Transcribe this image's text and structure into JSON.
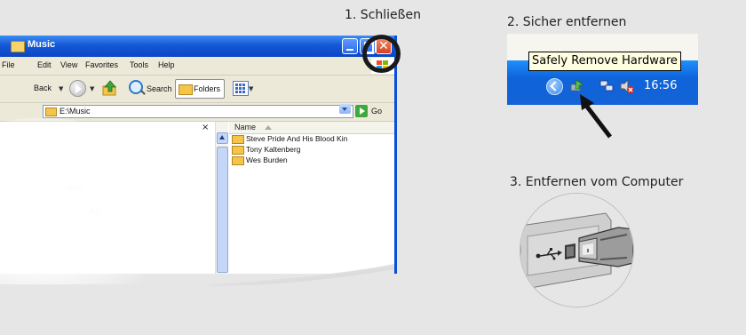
{
  "steps": {
    "step1": "1. Schließen",
    "step2": "2. Sicher entfernen",
    "step3": "3. Entfernen vom Computer"
  },
  "explorer": {
    "title": "Music",
    "menu": [
      "File",
      "Edit",
      "View",
      "Favorites",
      "Tools",
      "Help"
    ],
    "toolbar": {
      "back": "Back",
      "search": "Search",
      "folders": "Folders"
    },
    "address": "E:\\Music",
    "go": "Go",
    "pane_close": "×",
    "ghost_text": [
      "ents",
      "A:)"
    ],
    "column_name": "Name",
    "files": [
      "Steve Pride And His Blood Kin",
      "Tony Kaltenberg",
      "Wes Burden"
    ]
  },
  "tray": {
    "tooltip": "Safely Remove Hardware",
    "clock": "16:56"
  },
  "colors": {
    "title_blue": "#0b4fd6",
    "taskbar_blue": "#1463d8",
    "close_red": "#d6401c",
    "background": "#e6e6e6"
  },
  "icons": [
    "folder-icon",
    "minimize-icon",
    "maximize-icon",
    "close-icon",
    "windows-logo-icon",
    "back-icon",
    "forward-icon",
    "up-folder-icon",
    "search-icon",
    "folders-icon",
    "views-icon",
    "go-icon",
    "safely-remove-hardware-icon",
    "network-icon",
    "volume-icon",
    "usb-plug-icon",
    "usb-symbol-icon"
  ]
}
